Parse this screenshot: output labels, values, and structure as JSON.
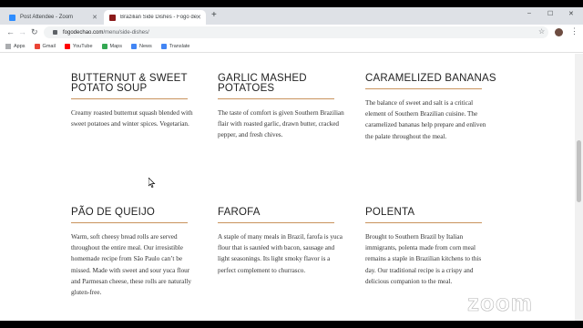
{
  "browser": {
    "tabs": [
      {
        "title": "Post Attendee - Zoom",
        "active": false,
        "favicon_color": "#2d8cff"
      },
      {
        "title": "Brazilian Side Dishes - Fogo de Chão",
        "active": true,
        "favicon_color": "#8b1a1a"
      }
    ],
    "new_tab": "+",
    "window_controls": [
      "–",
      "☐",
      "✕"
    ],
    "url_host": "fogodechao.com",
    "url_path": "/menu/side-dishes/",
    "bookmarks": [
      {
        "label": "Apps",
        "icon": "apps-grid-icon"
      },
      {
        "label": "Gmail",
        "icon": "gmail-icon",
        "color": "#ea4335"
      },
      {
        "label": "YouTube",
        "icon": "youtube-icon",
        "color": "#ff0000"
      },
      {
        "label": "Maps",
        "icon": "maps-icon",
        "color": "#34a853"
      },
      {
        "label": "News",
        "icon": "news-icon",
        "color": "#4285f4"
      },
      {
        "label": "Translate",
        "icon": "translate-icon",
        "color": "#4285f4"
      }
    ]
  },
  "dishes": [
    {
      "title": "Butternut & Sweet Potato Soup",
      "description": "Creamy roasted butternut squash blended with sweet potatoes and winter spices. Vegetarian."
    },
    {
      "title": "Garlic Mashed Potatoes",
      "description": "The taste of comfort is given Southern Brazilian flair with roasted garlic, drawn butter, cracked pepper, and fresh chives."
    },
    {
      "title": "Caramelized Bananas",
      "description": "The balance of sweet and salt is a critical element of Southern Brazilian cuisine. The caramelized bananas help prepare and enliven the palate throughout the meal."
    },
    {
      "title": "Pão de Queijo",
      "description": "Warm, soft cheesy bread rolls are served throughout the entire meal. Our irresistible homemade recipe from São Paulo can’t be missed. Made with sweet and sour yuca flour and Parmesan cheese, these rolls are naturally gluten-free."
    },
    {
      "title": "Farofa",
      "description": "A staple of many meals in Brazil, farofa is yuca flour that is sautéed with bacon, sausage and light seasonings. Its light smoky flavor is a perfect complement to churrasco."
    },
    {
      "title": "Polenta",
      "description": "Brought to Southern Brazil by Italian immigrants, polenta made from corn meal remains a staple in Brazilian kitchens to this day. Our traditional recipe is a crispy and delicious companion to the meal."
    }
  ],
  "overlay": {
    "watermark": "zoom"
  },
  "colors": {
    "accent_rule": "#c9935c"
  }
}
